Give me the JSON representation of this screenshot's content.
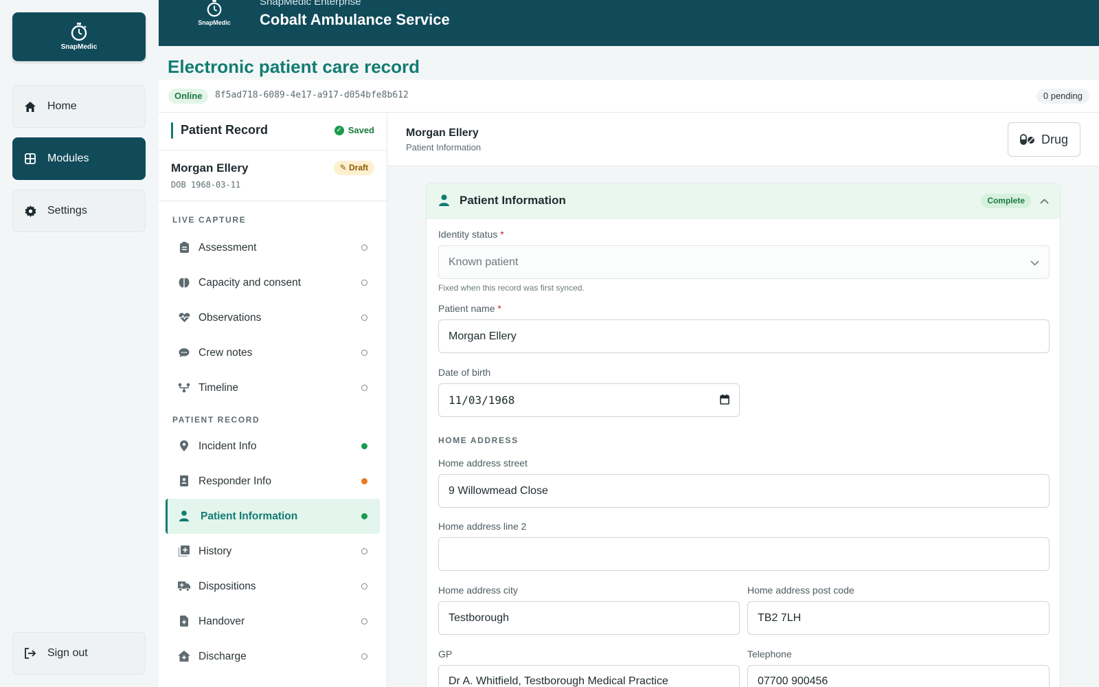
{
  "brand": {
    "logo_text": "SnapMedic",
    "header_subtitle": "SnapMedic Enterprise",
    "header_title": "Cobalt Ambulance Service",
    "accent_color": "#114b5a",
    "title_color": "#127c72"
  },
  "leftnav": {
    "home": "Home",
    "modules": "Modules",
    "settings": "Settings",
    "signout": "Sign out"
  },
  "page": {
    "title": "Electronic patient care record",
    "online": "Online",
    "record_id": "8f5ad718-6089-4e17-a917-d054bfe8b612",
    "pending": "0 pending"
  },
  "record_nav": {
    "title": "Patient Record",
    "saved": "Saved",
    "patient_name": "Morgan Ellery",
    "dob": "DOB 1968-03-11",
    "draft": "Draft",
    "live_capture_label": "LIVE CAPTURE",
    "live_items": [
      {
        "label": "Assessment",
        "icon": "clipboard-icon",
        "state": "empty"
      },
      {
        "label": "Capacity and consent",
        "icon": "brain-icon",
        "state": "empty"
      },
      {
        "label": "Observations",
        "icon": "heart-pulse-icon",
        "state": "empty"
      },
      {
        "label": "Crew notes",
        "icon": "chat-bubble-icon",
        "state": "empty"
      },
      {
        "label": "Timeline",
        "icon": "timeline-icon",
        "state": "empty"
      }
    ],
    "patient_record_label": "PATIENT RECORD",
    "record_items": [
      {
        "label": "Incident Info",
        "icon": "location-pin-icon",
        "state": "complete"
      },
      {
        "label": "Responder Info",
        "icon": "id-badge-icon",
        "state": "warning"
      },
      {
        "label": "Patient Information",
        "icon": "person-icon",
        "state": "complete"
      },
      {
        "label": "History",
        "icon": "history-icon",
        "state": "empty"
      },
      {
        "label": "Dispositions",
        "icon": "ambulance-icon",
        "state": "empty"
      },
      {
        "label": "Handover",
        "icon": "file-plus-icon",
        "state": "empty"
      },
      {
        "label": "Discharge",
        "icon": "house-medical-icon",
        "state": "empty"
      }
    ]
  },
  "main": {
    "patient_name": "Morgan Ellery",
    "section_subtitle": "Patient Information",
    "drug_button": "Drug",
    "card_title": "Patient Information",
    "card_status": "Complete",
    "form": {
      "identity_label": "Identity status",
      "identity_value": "Known patient",
      "identity_hint": "Fixed when this record was first synced.",
      "name_label": "Patient name",
      "name_value": "Morgan Ellery",
      "dob_label": "Date of birth",
      "dob_value": "11/03/1968",
      "home_address_group": "HOME ADDRESS",
      "street_label": "Home address street",
      "street_value": "9 Willowmead Close",
      "line2_label": "Home address line 2",
      "line2_value": "",
      "city_label": "Home address city",
      "city_value": "Testborough",
      "postcode_label": "Home address post code",
      "postcode_value": "TB2 7LH",
      "gp_label": "GP",
      "gp_value": "Dr A. Whitfield, Testborough Medical Practice",
      "telephone_label": "Telephone",
      "telephone_value": "07700 900456"
    }
  }
}
